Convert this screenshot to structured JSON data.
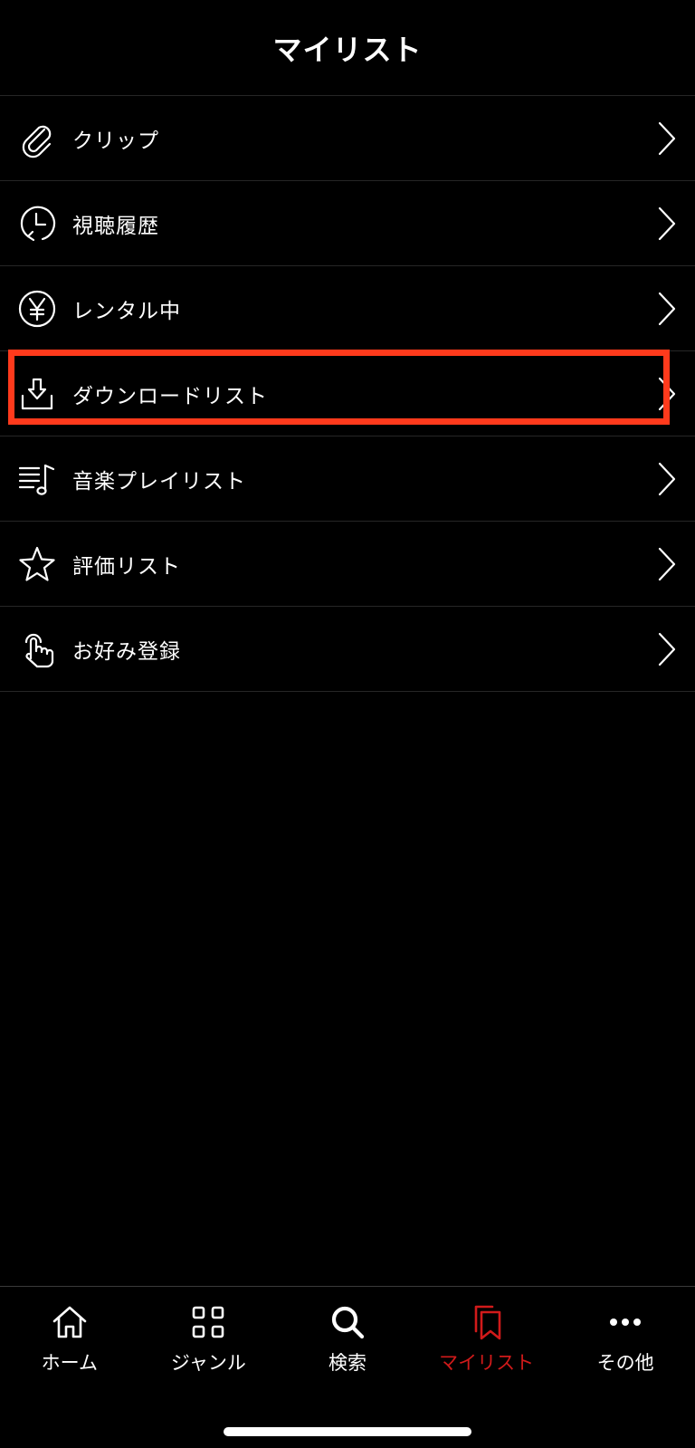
{
  "header": {
    "title": "マイリスト"
  },
  "menu": {
    "items": [
      {
        "label": "クリップ",
        "icon": "paperclip-icon"
      },
      {
        "label": "視聴履歴",
        "icon": "clock-history-icon"
      },
      {
        "label": "レンタル中",
        "icon": "yen-circle-icon"
      },
      {
        "label": "ダウンロードリスト",
        "icon": "download-tray-icon"
      },
      {
        "label": "音楽プレイリスト",
        "icon": "music-playlist-icon"
      },
      {
        "label": "評価リスト",
        "icon": "star-icon"
      },
      {
        "label": "お好み登録",
        "icon": "hand-pointer-icon"
      }
    ]
  },
  "tabbar": {
    "tabs": [
      {
        "label": "ホーム",
        "icon": "home-icon"
      },
      {
        "label": "ジャンル",
        "icon": "grid-icon"
      },
      {
        "label": "検索",
        "icon": "search-icon"
      },
      {
        "label": "マイリスト",
        "icon": "mylist-icon",
        "active": true
      },
      {
        "label": "その他",
        "icon": "more-dots-icon"
      }
    ]
  },
  "colors": {
    "background": "#000000",
    "accent_red": "#d11a1a",
    "highlight_annotation": "#ff3a1c",
    "divider": "#262626"
  }
}
